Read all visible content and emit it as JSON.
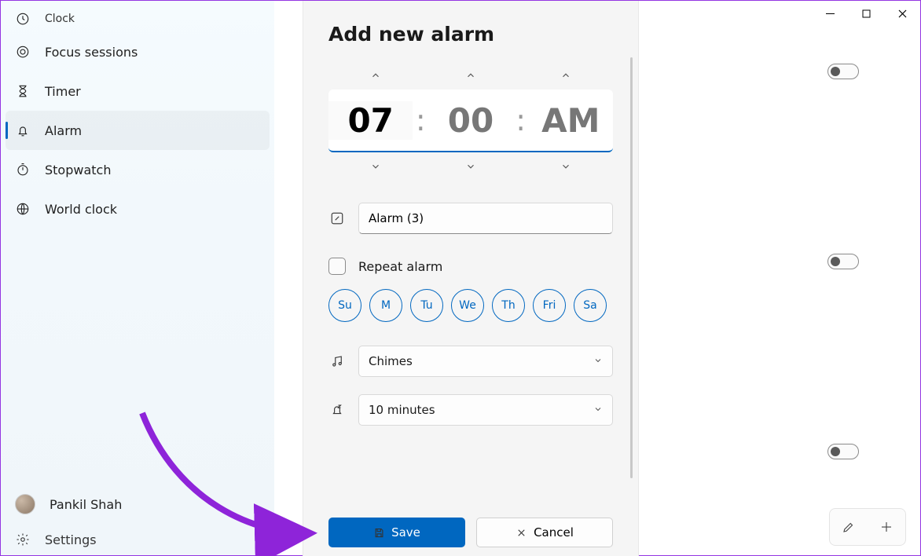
{
  "app_title": "Clock",
  "sidebar": {
    "items": [
      {
        "label": "Focus sessions"
      },
      {
        "label": "Timer"
      },
      {
        "label": "Alarm"
      },
      {
        "label": "Stopwatch"
      },
      {
        "label": "World clock"
      }
    ],
    "user_name": "Pankil Shah",
    "settings_label": "Settings"
  },
  "panel": {
    "title": "Add new alarm",
    "time": {
      "hour": "07",
      "minute": "00",
      "period": "AM"
    },
    "alarm_name": "Alarm (3)",
    "repeat_label": "Repeat alarm",
    "days": [
      "Su",
      "M",
      "Tu",
      "We",
      "Th",
      "Fri",
      "Sa"
    ],
    "sound_value": "Chimes",
    "snooze_value": "10 minutes",
    "save_label": "Save",
    "cancel_label": "Cancel"
  }
}
